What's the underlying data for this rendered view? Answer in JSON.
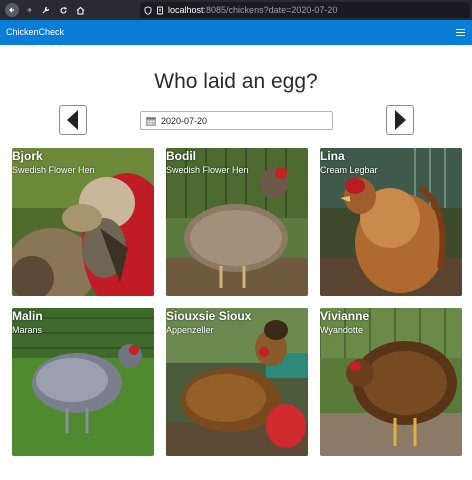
{
  "browser": {
    "url_host": "localhost",
    "url_rest": ":8085/chickens?date=2020-07-20"
  },
  "app": {
    "brand": "ChickenCheck"
  },
  "page": {
    "title": "Who laid an egg?",
    "date_value": "2020-07-20"
  },
  "chickens": [
    {
      "name": "Bjork",
      "breed": "Swedish Flower Hen"
    },
    {
      "name": "Bodil",
      "breed": "Swedish Flower Hen"
    },
    {
      "name": "Lina",
      "breed": "Cream Legbar"
    },
    {
      "name": "Malin",
      "breed": "Marans"
    },
    {
      "name": "Siouxsie Sioux",
      "breed": "Appenzeller"
    },
    {
      "name": "Vivianne",
      "breed": "Wyandotte"
    }
  ],
  "colors": {
    "navbar": "#0a7ed6",
    "browser_chrome": "#2b2a33"
  },
  "icons": [
    "back-arrow-icon",
    "forward-arrow-icon",
    "reload-icon",
    "home-icon",
    "shield-icon",
    "hamburger-menu-icon",
    "calendar-icon",
    "left-triangle-icon",
    "right-triangle-icon"
  ]
}
